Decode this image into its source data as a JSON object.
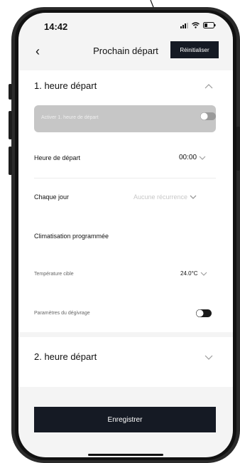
{
  "status_bar": {
    "time": "14:42"
  },
  "nav": {
    "back_icon": "chevron-left",
    "title": "Prochain départ",
    "reset_label": "Réinitialiser"
  },
  "section1": {
    "title": "1. heure départ",
    "enable_label": "Activer 1. heure de départ",
    "departure_time_label": "Heure de départ",
    "departure_time_value": "00:00",
    "repeat_label": "Chaque jour",
    "repeat_value": "Aucune récurrence",
    "climate_label": "Climatisation programmée",
    "temperature_label": "Température cible",
    "temperature_value": "24.0°C",
    "defrost_label": "Paramètres du dégivrage"
  },
  "section2": {
    "title": "2. heure départ"
  },
  "footer": {
    "save_label": "Enregistrer"
  },
  "colors": {
    "accent": "#151a24",
    "disabled": "#c6c6c6"
  }
}
